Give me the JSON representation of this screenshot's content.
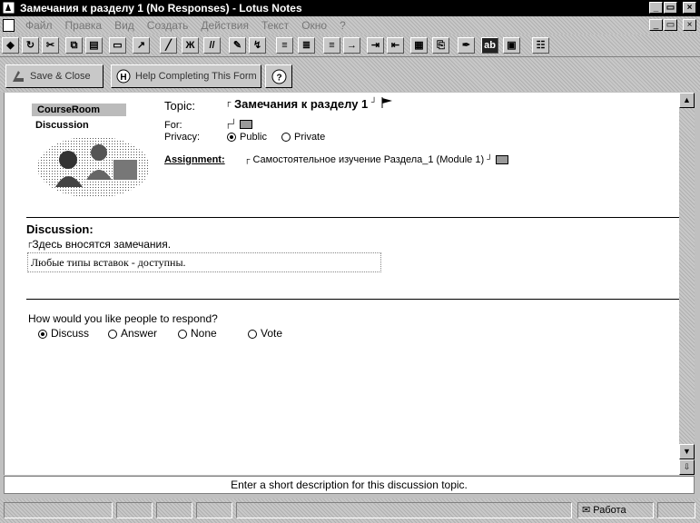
{
  "window": {
    "title": "Замечания к разделу 1 (No Responses) - Lotus Notes",
    "app_icon": "lotus-notes-icon",
    "controls": {
      "minimize": "_",
      "maximize": "▭",
      "close": "×"
    },
    "doc_controls": {
      "minimize": "_",
      "restore": "▭",
      "close": "×"
    }
  },
  "menu": {
    "items": [
      "Файл",
      "Правка",
      "Вид",
      "Создать",
      "Действия",
      "Текст",
      "Окно",
      "?"
    ]
  },
  "toolbar": {
    "buttons": [
      "save-icon",
      "refresh-icon",
      "stop-icon",
      "copy-icon",
      "paste-icon",
      "print-icon",
      "link-icon",
      "line-icon",
      "bold-icon",
      "italic-icon",
      "highlight-icon",
      "format-icon",
      "bullets-icon",
      "numbering-icon",
      "align-left-icon",
      "align-center-icon",
      "indent-icon",
      "outdent-icon",
      "table-icon",
      "attach-icon",
      "pen-icon",
      "abc-icon",
      "screen-icon",
      "properties-icon"
    ],
    "bold_label": "Ж",
    "italic_label": "//"
  },
  "actions": {
    "save_close": "Save & Close",
    "help_completing": "Help Completing This Form",
    "help_icon_label": "?"
  },
  "logo": {
    "name1": "CourseRoom",
    "name2": "Discussion"
  },
  "form": {
    "topic_label": "Topic:",
    "topic_value": "Замечания к разделу 1",
    "for_label": "For:",
    "privacy_label": "Privacy:",
    "privacy_public": "Public",
    "privacy_private": "Private",
    "privacy_selected": "Public",
    "assignment_label": "Assignment",
    "assignment_value": "Самостоятельное изучение Раздела_1 (Module 1)",
    "discussion_heading": "Discussion:",
    "discussion_text": "Здесь вносятся замечания.",
    "discussion_field": "Любые типы вставок - доступны.",
    "respond_question": "How would you like people to respond?",
    "respond_options": [
      "Discuss",
      "Answer",
      "None",
      "Vote"
    ],
    "respond_selected": "Discuss"
  },
  "hint": "Enter a short description for this discussion topic.",
  "status": {
    "office": "Работа"
  },
  "scroll": {
    "up": "▲",
    "down": "▼",
    "page": "⇩"
  }
}
